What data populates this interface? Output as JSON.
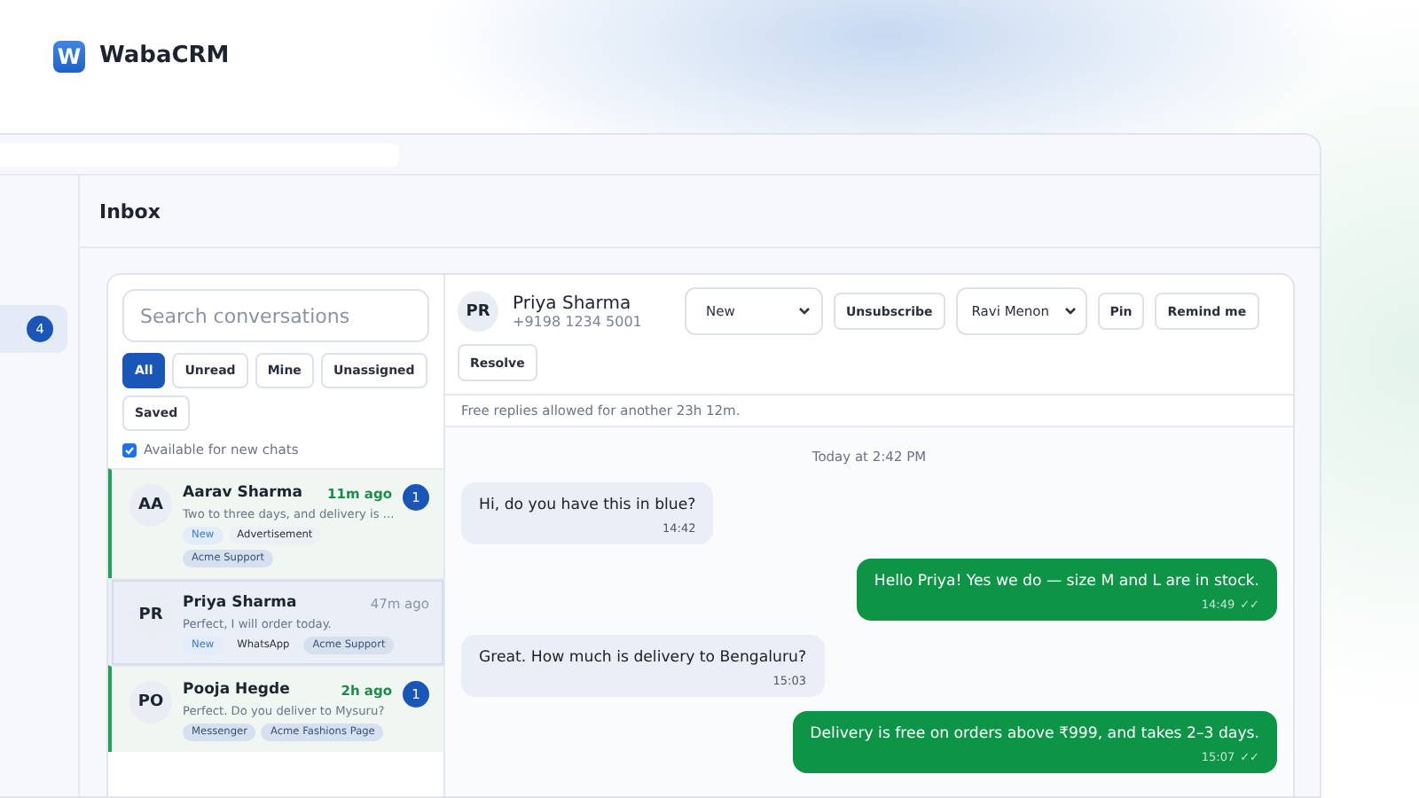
{
  "brand": {
    "name": "WabaCRM",
    "logo_letter": "W"
  },
  "sidebar": {
    "items": [
      {
        "badge": "4",
        "selected": true
      }
    ]
  },
  "page": {
    "title": "Inbox"
  },
  "conversations": {
    "search": {
      "placeholder": "Search conversations"
    },
    "filters": [
      {
        "label": "All",
        "selected": true
      },
      {
        "label": "Unread",
        "selected": false
      },
      {
        "label": "Mine",
        "selected": false
      },
      {
        "label": "Unassigned",
        "selected": false
      },
      {
        "label": "Saved",
        "selected": false
      }
    ],
    "availability": {
      "label": "Available for new chats",
      "checked": true
    },
    "items": [
      {
        "initials": "AA",
        "name": "Aarav Sharma",
        "time": "11m ago",
        "preview": "Two to three days, and delivery is ...",
        "unread_count": "1",
        "unread": true,
        "selected": false,
        "tags": [
          {
            "label": "New",
            "kind": "status"
          },
          {
            "label": "Advertisement",
            "kind": "source"
          },
          {
            "label": "Acme Support",
            "kind": "team"
          }
        ]
      },
      {
        "initials": "PR",
        "name": "Priya Sharma",
        "time": "47m ago",
        "preview": "Perfect, I will order today.",
        "unread": false,
        "selected": true,
        "tags": [
          {
            "label": "New",
            "kind": "status"
          },
          {
            "label": "WhatsApp",
            "kind": "channel"
          },
          {
            "label": "Acme Support",
            "kind": "team"
          }
        ]
      },
      {
        "initials": "PO",
        "name": "Pooja Hegde",
        "time": "2h ago",
        "preview": "Perfect. Do you deliver to Mysuru?",
        "unread_count": "1",
        "unread": true,
        "selected": false,
        "tags": [
          {
            "label": "Messenger",
            "kind": "team"
          },
          {
            "label": "Acme Fashions Page",
            "kind": "team"
          }
        ]
      }
    ]
  },
  "chat": {
    "contact": {
      "initials": "PR",
      "name": "Priya Sharma",
      "phone": "+9198 1234 5001"
    },
    "actions": [
      {
        "kind": "select",
        "label": "New"
      },
      {
        "kind": "button",
        "label": "Unsubscribe"
      },
      {
        "kind": "select",
        "label": "Ravi Menon"
      },
      {
        "kind": "button",
        "label": "Pin"
      },
      {
        "kind": "button",
        "label": "Remind me"
      },
      {
        "kind": "button",
        "label": "Resolve"
      }
    ],
    "notice": "Free replies allowed for another 23h 12m.",
    "date_divider": "Today at 2:42 PM",
    "messages": [
      {
        "kind": "incoming",
        "text": "Hi, do you have this in blue?",
        "time": "14:42"
      },
      {
        "kind": "outgoing",
        "text": "Hello Priya! Yes we do — size M and L are in stock.",
        "time": "14:49",
        "status": "✓✓"
      },
      {
        "kind": "incoming",
        "text": "Great. How much is delivery to Bengaluru?",
        "time": "15:03"
      },
      {
        "kind": "outgoing",
        "text": "Delivery is free on orders above ₹999, and takes 2–3 days.",
        "time": "15:07",
        "status": "✓✓"
      }
    ]
  }
}
